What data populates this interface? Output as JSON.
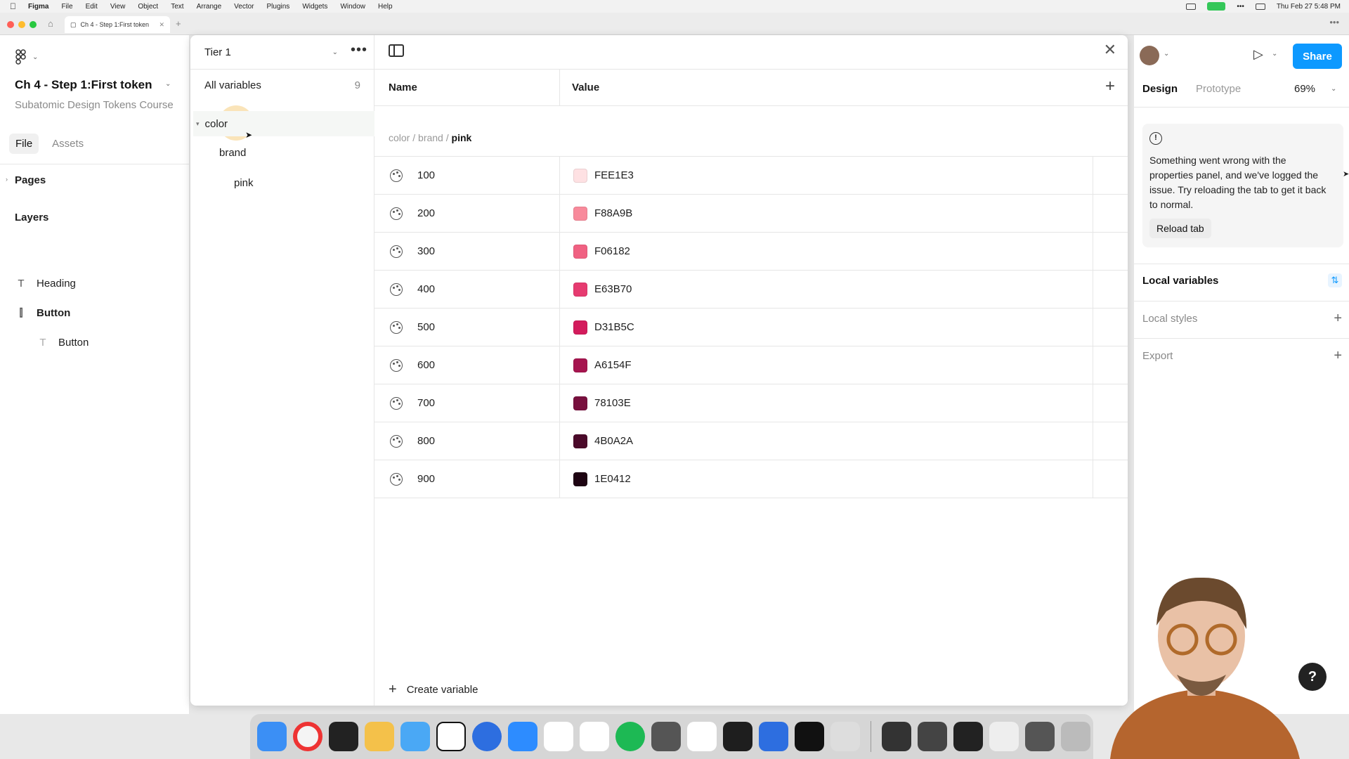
{
  "menubar": {
    "app": "Figma",
    "items": [
      "File",
      "Edit",
      "View",
      "Object",
      "Text",
      "Arrange",
      "Vector",
      "Plugins",
      "Widgets",
      "Window",
      "Help"
    ],
    "datetime": "Thu Feb 27  5:48 PM"
  },
  "browser": {
    "tab_title": "Ch 4 - Step 1:First token"
  },
  "left_panel": {
    "file_title": "Ch 4 - Step 1:First token",
    "file_subtitle": "Subatomic Design Tokens Course",
    "tabs": [
      "File",
      "Assets"
    ],
    "pages_label": "Pages",
    "layers_label": "Layers",
    "layers": [
      {
        "name": "Heading",
        "icon": "text-icon"
      },
      {
        "name": "Button",
        "icon": "frame-icon"
      },
      {
        "name": "Button",
        "icon": "text-icon"
      }
    ]
  },
  "variables_modal": {
    "collection": "Tier 1",
    "all_variables_label": "All variables",
    "all_variables_count": "9",
    "groups": [
      "color",
      "brand",
      "pink"
    ],
    "columns": {
      "name": "Name",
      "value": "Value"
    },
    "breadcrumb": {
      "part1": "color",
      "part2": "brand",
      "current": "pink",
      "sep": " / "
    },
    "rows": [
      {
        "name": "100",
        "hex": "FEE1E3",
        "color": "#FEE1E3"
      },
      {
        "name": "200",
        "hex": "F88A9B",
        "color": "#F88A9B"
      },
      {
        "name": "300",
        "hex": "F06182",
        "color": "#F06182"
      },
      {
        "name": "400",
        "hex": "E63B70",
        "color": "#E63B70"
      },
      {
        "name": "500",
        "hex": "D31B5C",
        "color": "#D31B5C"
      },
      {
        "name": "600",
        "hex": "A6154F",
        "color": "#A6154F"
      },
      {
        "name": "700",
        "hex": "78103E",
        "color": "#78103E"
      },
      {
        "name": "800",
        "hex": "4B0A2A",
        "color": "#4B0A2A"
      },
      {
        "name": "900",
        "hex": "1E0412",
        "color": "#1E0412"
      }
    ],
    "create_label": "Create variable"
  },
  "right_panel": {
    "share_label": "Share",
    "tabs": [
      "Design",
      "Prototype"
    ],
    "zoom": "69%",
    "error_message": "Something went wrong with the properties panel, and we've logged the issue. Try reloading the tab to get it back to normal.",
    "reload_label": "Reload tab",
    "local_variables": "Local variables",
    "local_styles": "Local styles",
    "export": "Export"
  },
  "help_label": "?"
}
